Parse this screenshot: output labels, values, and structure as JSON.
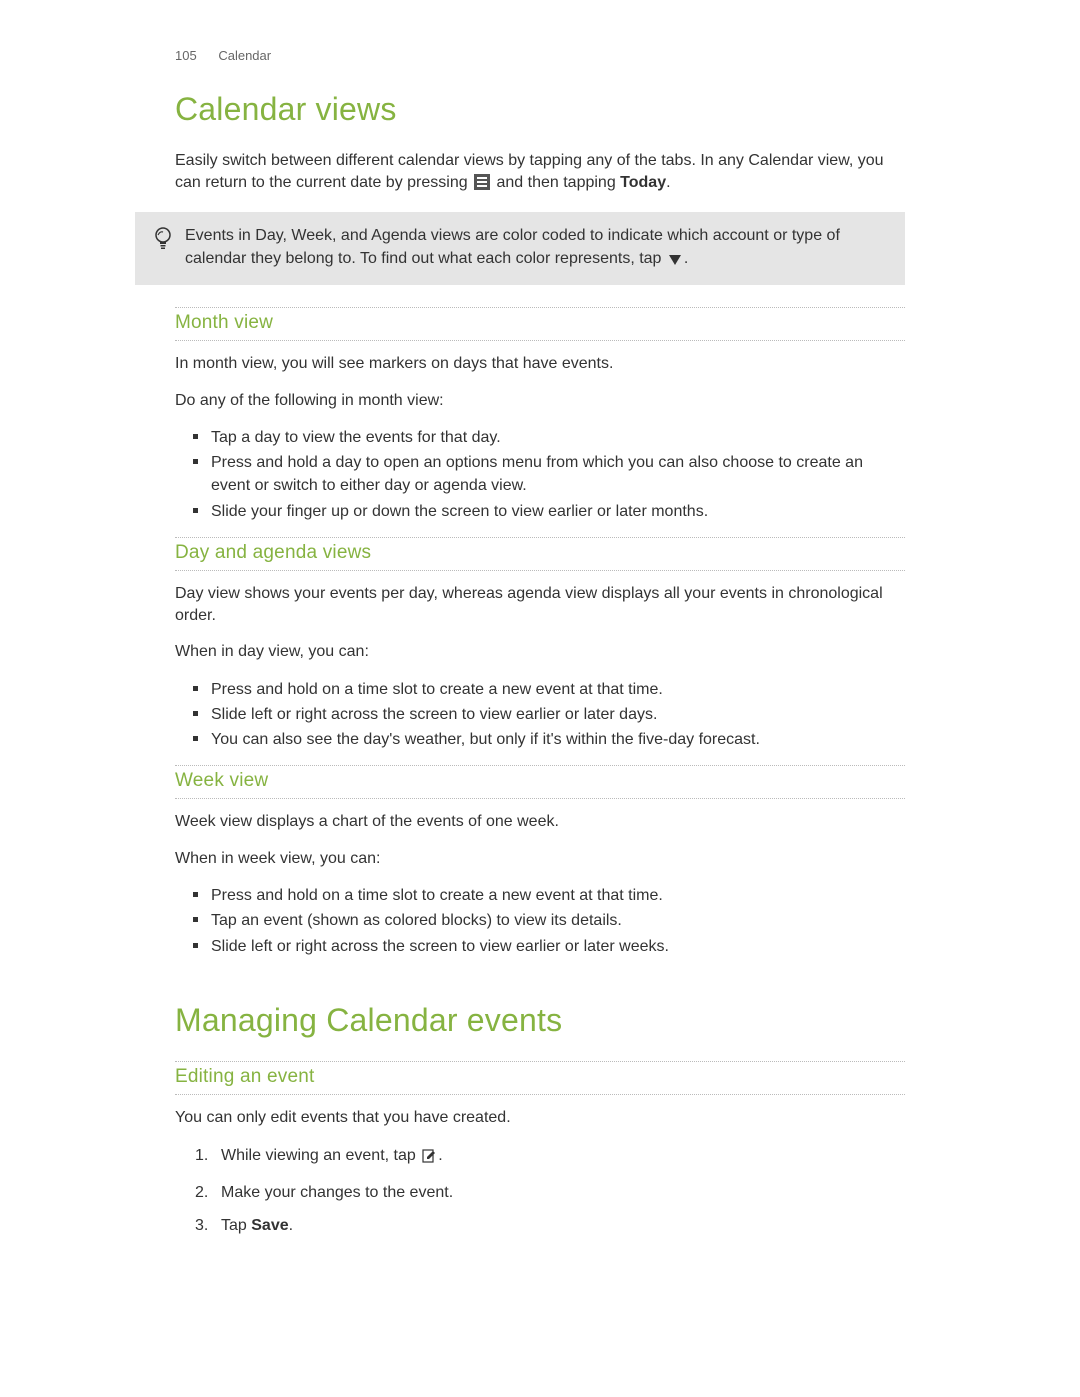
{
  "header": {
    "page_number": "105",
    "section": "Calendar"
  },
  "h1_views": "Calendar views",
  "intro": {
    "part1": "Easily switch between different calendar views by tapping any of the tabs. In any Calendar view, you can return to the current date by pressing ",
    "part2": " and then tapping ",
    "today": "Today",
    "period": "."
  },
  "tip": {
    "part1": "Events in Day, Week, and Agenda views are color coded to indicate which account or type of calendar they belong to. To find out what each color represents, tap ",
    "period": "."
  },
  "month": {
    "heading": "Month view",
    "p1": "In month view, you will see markers on days that have events.",
    "p2": "Do any of the following in month view:",
    "bullets": [
      "Tap a day to view the events for that day.",
      "Press and hold a day to open an options menu from which you can also choose to create an event or switch to either day or agenda view.",
      "Slide your finger up or down the screen to view earlier or later months."
    ]
  },
  "day": {
    "heading": "Day and agenda views",
    "p1": "Day view shows your events per day, whereas agenda view displays all your events in chronological order.",
    "p2": "When in day view, you can:",
    "bullets": [
      "Press and hold on a time slot to create a new event at that time.",
      "Slide left or right across the screen to view earlier or later days.",
      "You can also see the day's weather, but only if it's within the five-day forecast."
    ]
  },
  "week": {
    "heading": "Week view",
    "p1": "Week view displays a chart of the events of one week.",
    "p2": "When in week view, you can:",
    "bullets": [
      "Press and hold on a time slot to create a new event at that time.",
      "Tap an event (shown as colored blocks) to view its details.",
      "Slide left or right across the screen to view earlier or later weeks."
    ]
  },
  "h1_manage": "Managing Calendar events",
  "edit": {
    "heading": "Editing an event",
    "p1": "You can only edit events that you have created.",
    "steps": {
      "s1a": "While viewing an event, tap ",
      "s1b": ".",
      "s2": "Make your changes to the event.",
      "s3a": "Tap ",
      "s3_save": "Save",
      "s3b": "."
    }
  }
}
